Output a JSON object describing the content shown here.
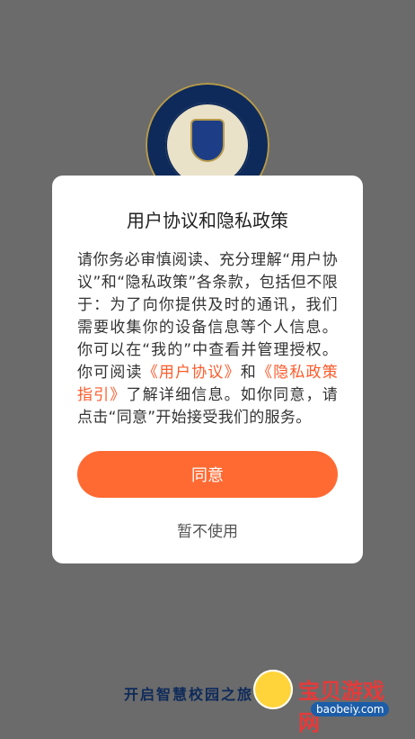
{
  "background": {
    "slogan": "开启智慧校园之旅"
  },
  "dialog": {
    "title": "用户协议和隐私政策",
    "body": {
      "part1": "请你务必审慎阅读、充分理解“用户协议”和“隐私政策”各条款，包括但不限于：为了向你提供及时的通讯，我们需要收集你的设备信息等个人信息。你可以在“我的”中查看并管理授权。你可阅读",
      "link1": "《用户协议》",
      "part2": "和",
      "link2": "《隐私政策指引》",
      "part3": "了解详细信息。如你同意，请点击“同意”开始接受我们的服务。"
    },
    "agree_label": "同意",
    "decline_label": "暂不使用"
  },
  "watermark": {
    "text": "宝贝游戏网",
    "url": "baobeiy.com"
  },
  "colors": {
    "accent": "#ff6a33",
    "link": "#ff5a2a"
  }
}
